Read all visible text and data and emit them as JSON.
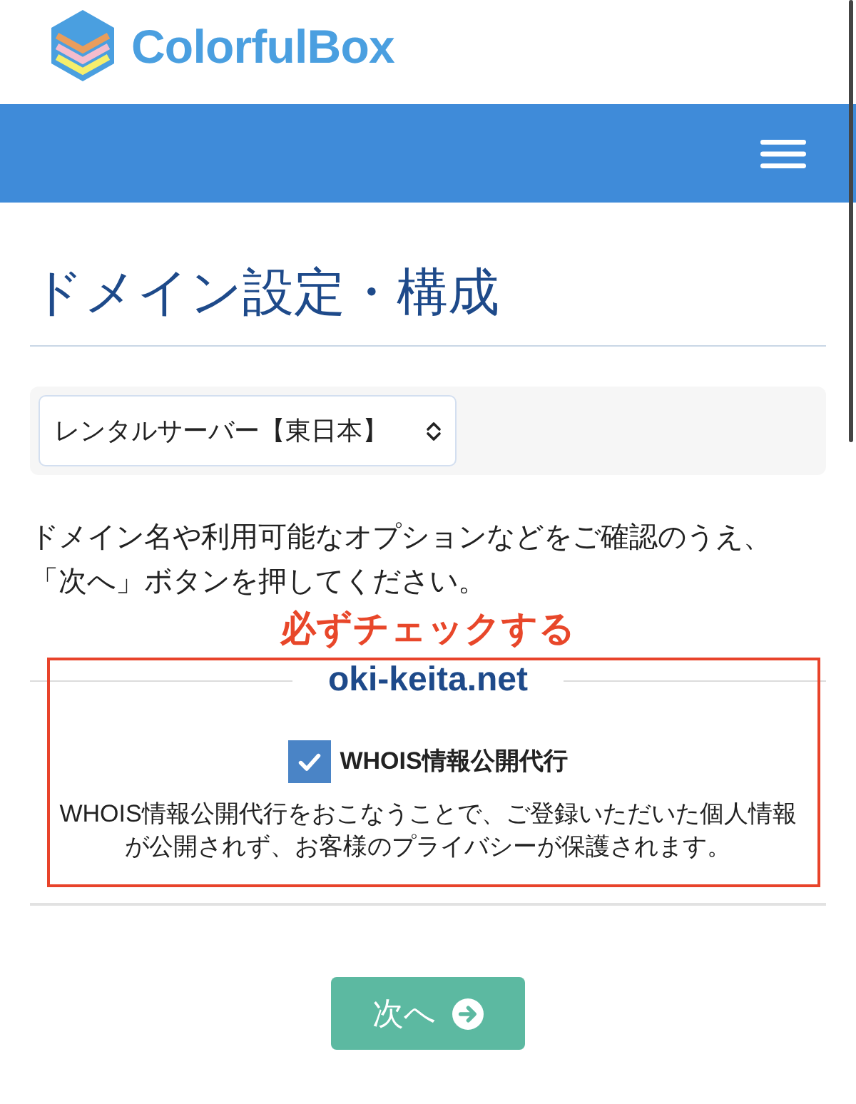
{
  "header": {
    "logo_text": "ColorfulBox"
  },
  "page_title": "ドメイン設定・構成",
  "server_select": {
    "value": "レンタルサーバー【東日本】"
  },
  "instructions": "ドメイン名や利用可能なオプションなどをご確認のうえ、「次へ」ボタンを押してください。",
  "callout": "必ずチェックする",
  "domain": {
    "name": "oki-keita.net",
    "options": [
      {
        "label": "WHOIS情報公開代行",
        "checked": true,
        "description": "WHOIS情報公開代行をおこなうことで、ご登録いただいた個人情報が公開されず、お客様のプライバシーが保護されます。"
      }
    ]
  },
  "next_button": {
    "label": "次へ"
  }
}
